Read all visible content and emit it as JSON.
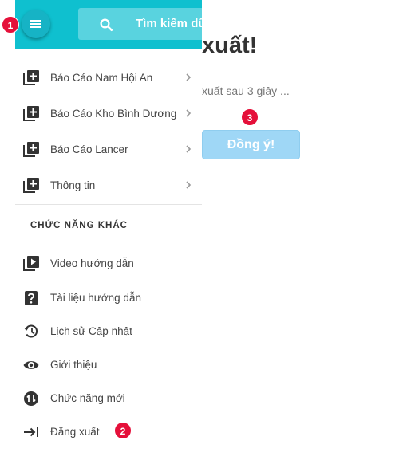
{
  "background": {
    "title": "xuất!",
    "message": "xuất sau 3 giây ...",
    "button_label": "Đồng ý!"
  },
  "header": {
    "search_placeholder": "Tìm kiếm dữ",
    "icons": [
      "menu-icon",
      "search-icon"
    ],
    "color": "#0fc0cf"
  },
  "menu": {
    "items": [
      {
        "label": "Báo Cáo Nam Hội An",
        "icon": "library-add-icon"
      },
      {
        "label": "Báo Cáo Kho Bình Dương",
        "icon": "library-add-icon"
      },
      {
        "label": "Báo Cáo Lancer",
        "icon": "library-add-icon"
      },
      {
        "label": "Thông tin",
        "icon": "library-add-icon"
      }
    ],
    "section_title": "CHỨC NĂNG KHÁC",
    "other_items": [
      {
        "label": "Video hướng dẫn",
        "icon": "video-library-icon"
      },
      {
        "label": "Tài liệu hướng dẫn",
        "icon": "help-icon"
      },
      {
        "label": "Lịch sử Cập nhật",
        "icon": "history-icon"
      },
      {
        "label": "Giới thiệu",
        "icon": "eye-icon"
      },
      {
        "label": "Chức năng mới",
        "icon": "update-icon"
      },
      {
        "label": "Đăng xuất",
        "icon": "logout-icon"
      }
    ]
  },
  "steps": {
    "one": "1",
    "two": "2",
    "three": "3"
  },
  "colors": {
    "badge": "#e5103a",
    "button": "#9fd7f6"
  }
}
